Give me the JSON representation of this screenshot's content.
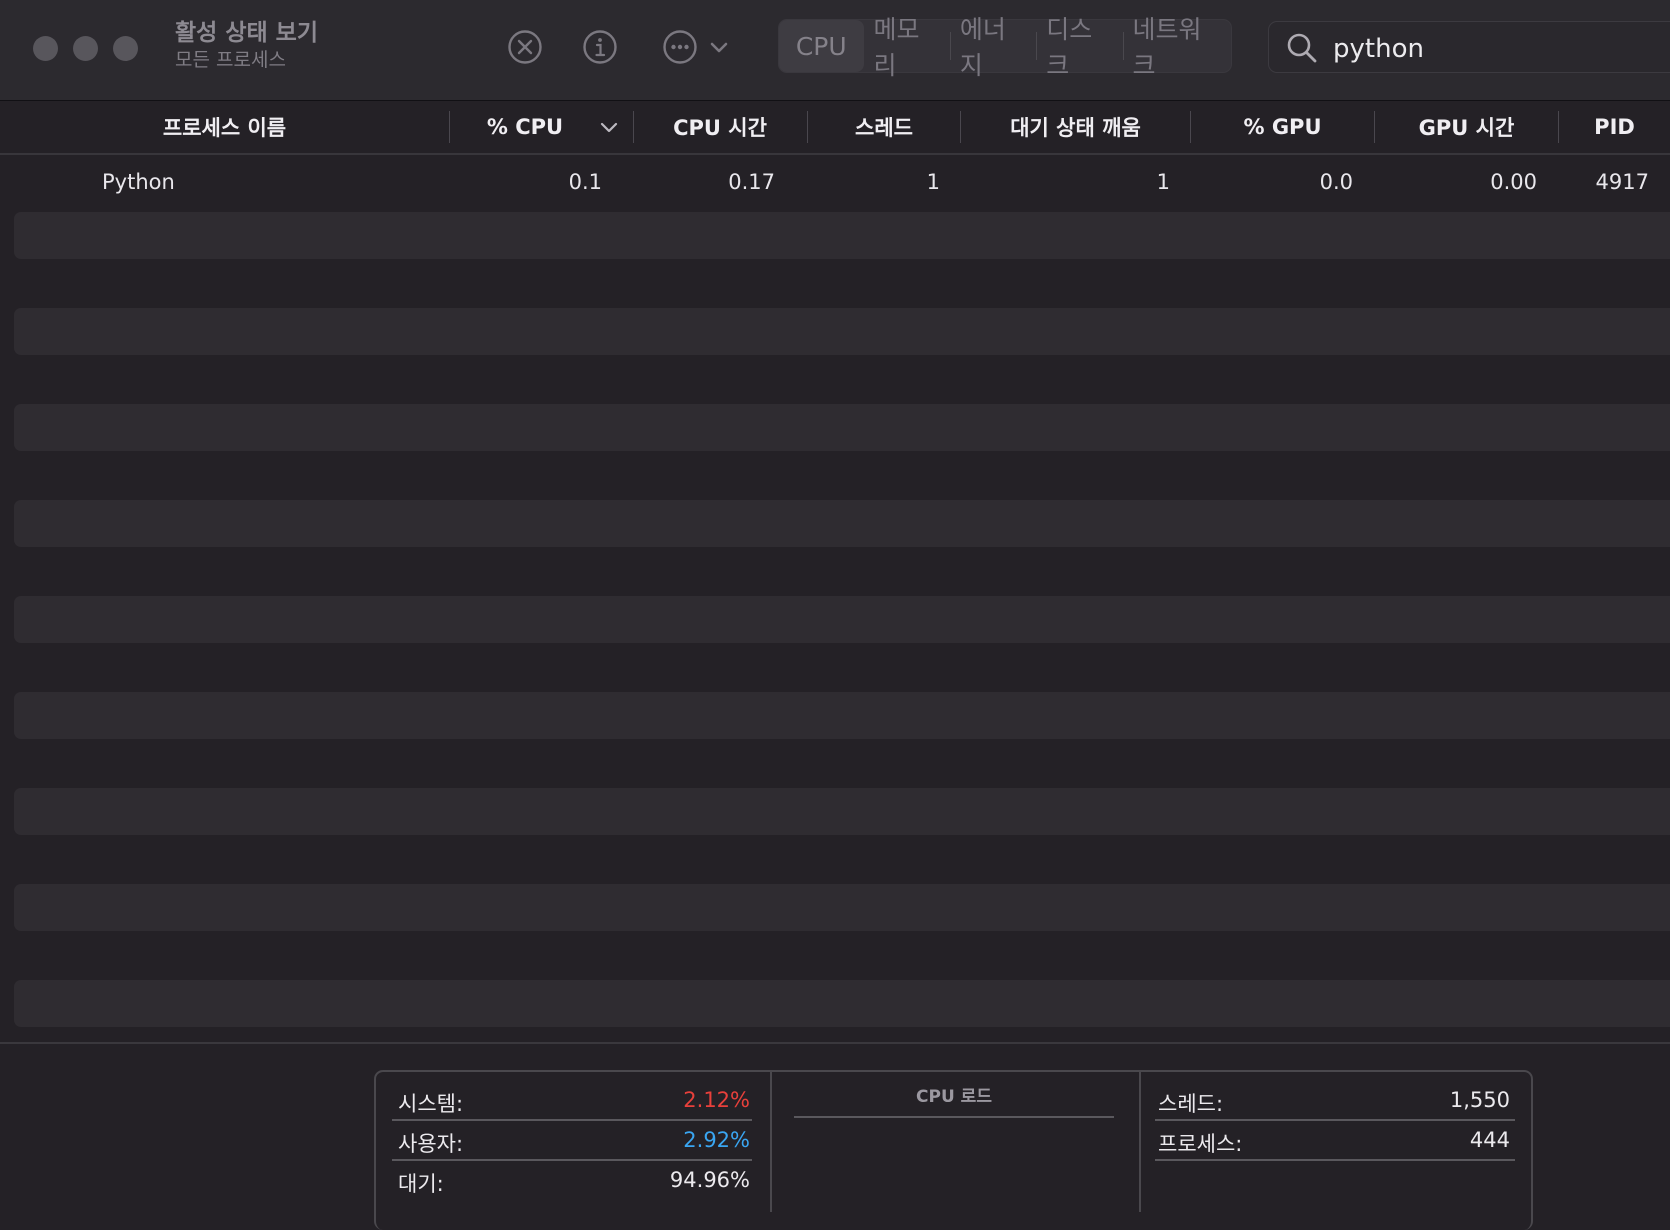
{
  "window": {
    "title": "활성 상태 보기",
    "subtitle": "모든 프로세스"
  },
  "toolbar": {
    "stop_icon": "x-circle-icon",
    "info_icon": "info-circle-icon",
    "more_icon": "ellipsis-circle-icon",
    "tabs": [
      {
        "label": "CPU",
        "active": true
      },
      {
        "label": "메모리",
        "active": false
      },
      {
        "label": "에너지",
        "active": false
      },
      {
        "label": "디스크",
        "active": false
      },
      {
        "label": "네트워크",
        "active": false
      }
    ]
  },
  "search": {
    "value": "python",
    "placeholder": "검색"
  },
  "table": {
    "columns": [
      "프로세스 이름",
      "% CPU",
      "CPU 시간",
      "스레드",
      "대기 상태 깨움",
      "% GPU",
      "GPU 시간",
      "PID"
    ],
    "sort_column": "% CPU",
    "rows": [
      [
        "Python",
        "0.1",
        "0.17",
        "1",
        "1",
        "0.0",
        "0.00",
        "4917"
      ]
    ]
  },
  "stats": {
    "system_label": "시스템:",
    "system_value": "2.12%",
    "user_label": "사용자:",
    "user_value": "2.92%",
    "idle_label": "대기:",
    "idle_value": "94.96%",
    "cpu_load_title": "CPU 로드",
    "threads_label": "스레드:",
    "threads_value": "1,550",
    "processes_label": "프로세스:",
    "processes_value": "444"
  },
  "colors": {
    "system": "#e8403b",
    "user": "#3aa6f2"
  }
}
